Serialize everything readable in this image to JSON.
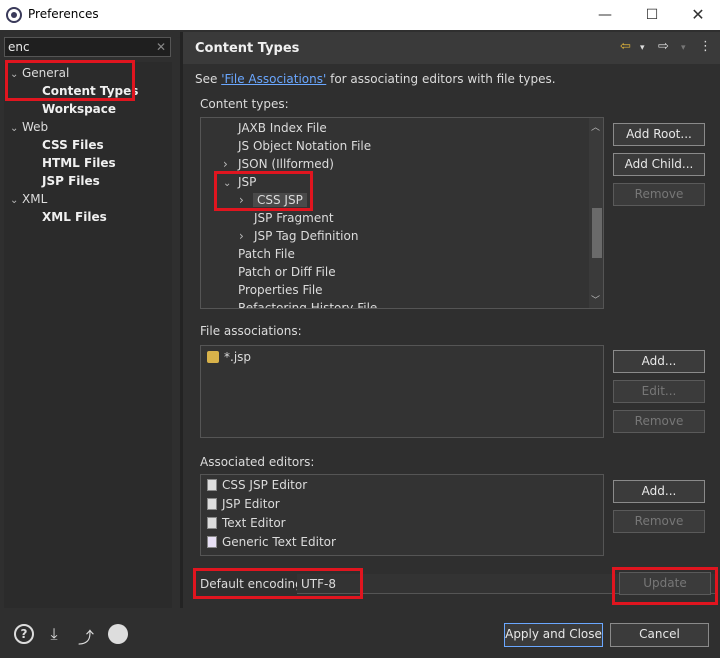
{
  "window": {
    "title": "Preferences",
    "min": "—",
    "max": "☐",
    "close": "✕"
  },
  "filter": {
    "value": "enc",
    "clear": "✕"
  },
  "nav": {
    "general": "General",
    "content_types": "Content Types",
    "workspace": "Workspace",
    "web": "Web",
    "css_files": "CSS Files",
    "html_files": "HTML Files",
    "jsp_files": "JSP Files",
    "xml": "XML",
    "xml_files": "XML Files"
  },
  "page": {
    "title": "Content Types",
    "note_prefix": "See ",
    "note_link": "'File Associations'",
    "note_suffix": " for associating editors with file types.",
    "content_types_label": "Content types:",
    "file_assoc_label": "File associations:",
    "assoc_editors_label": "Associated editors:",
    "default_encoding_label": "Default encoding:",
    "default_encoding_value": "UTF-8"
  },
  "content_types": [
    "JAXB Index File",
    "JS Object Notation File",
    "JSON (Illformed)",
    "JSP",
    "CSS JSP",
    "JSP Fragment",
    "JSP Tag Definition",
    "Patch File",
    "Patch or Diff File",
    "Properties File",
    "Refactoring History File"
  ],
  "file_associations": [
    "*.jsp"
  ],
  "editors": [
    "CSS JSP Editor",
    "JSP Editor",
    "Text Editor",
    "Generic Text Editor"
  ],
  "buttons": {
    "add_root": "Add Root...",
    "add_child": "Add Child...",
    "remove": "Remove",
    "add": "Add...",
    "edit": "Edit...",
    "update": "Update",
    "apply_close": "Apply and Close",
    "cancel": "Cancel"
  }
}
